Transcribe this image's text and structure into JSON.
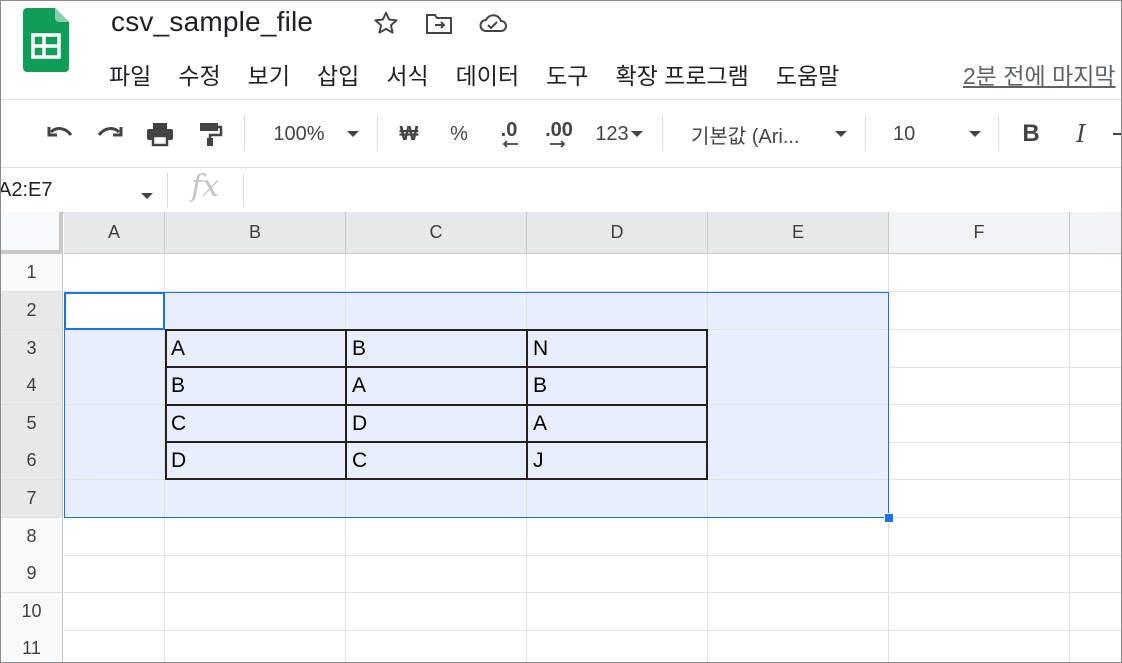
{
  "app": {
    "doc_title": "csv_sample_file",
    "brand_color": "#0f9d58"
  },
  "menu": [
    "파일",
    "수정",
    "보기",
    "삽입",
    "서식",
    "데이터",
    "도구",
    "확장 프로그램",
    "도움말"
  ],
  "last_edit": "2분 전에 마지막",
  "toolbar": {
    "zoom": "100%",
    "currency": "₩",
    "percent": "%",
    "dec_decrease": ".0",
    "dec_increase": ".00",
    "number_format": "123",
    "font": "기본값 (Ari...",
    "font_size": "10",
    "bold": "B",
    "italic": "I"
  },
  "formula_bar": {
    "name_box": "A2:E7",
    "fx_label": "fx",
    "value": ""
  },
  "columns": [
    "A",
    "B",
    "C",
    "D",
    "E",
    "F"
  ],
  "rows": [
    "1",
    "2",
    "3",
    "4",
    "5",
    "6",
    "7",
    "8",
    "9",
    "10",
    "11"
  ],
  "cells": {
    "B3": "A",
    "C3": "B",
    "D3": "N",
    "B4": "B",
    "C4": "A",
    "D4": "B",
    "B5": "C",
    "C5": "D",
    "D5": "A",
    "B6": "D",
    "C6": "C",
    "D6": "J"
  },
  "selection": {
    "range": "A2:E7",
    "active": "A2",
    "highlight_color": "#1a73e8"
  }
}
